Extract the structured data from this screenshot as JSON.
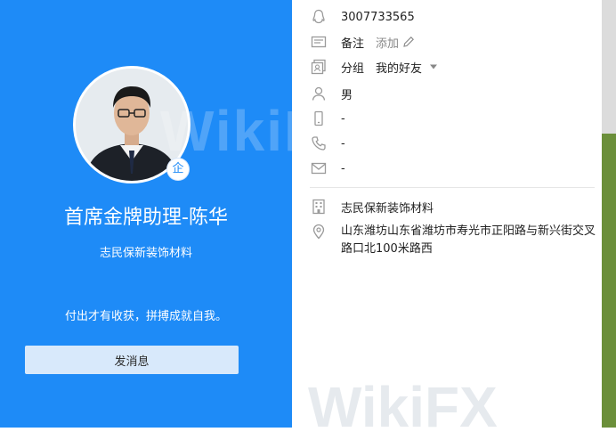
{
  "profile": {
    "name": "首席金牌助理-陈华",
    "company": "志民保新装饰材料",
    "signature": "付出才有收获，拼搏成就自我。",
    "enterprise_badge": "企",
    "send_message_label": "发消息"
  },
  "details": {
    "qq": "3007733565",
    "remark_label": "备注",
    "remark_action": "添加",
    "group_label": "分组",
    "group_value": "我的好友",
    "gender": "男",
    "mobile": "-",
    "phone": "-",
    "email": "-",
    "company": "志民保新装饰材料",
    "address": "山东潍坊山东省潍坊市寿光市正阳路与新兴街交叉路口北100米路西"
  },
  "watermark": "WikiFX",
  "icons": {
    "qq": "penguin-icon",
    "remark": "id-card-icon",
    "group": "contacts-icon",
    "gender": "person-icon",
    "mobile": "mobile-icon",
    "phone": "phone-icon",
    "email": "mail-icon",
    "company": "building-icon",
    "address": "location-pin-icon",
    "edit": "pencil-icon",
    "dropdown": "caret-down-icon"
  },
  "colors": {
    "panel_blue": "#1e8bf7",
    "button_bg": "#d8e9fb",
    "icon_gray": "#9a9a9a"
  }
}
